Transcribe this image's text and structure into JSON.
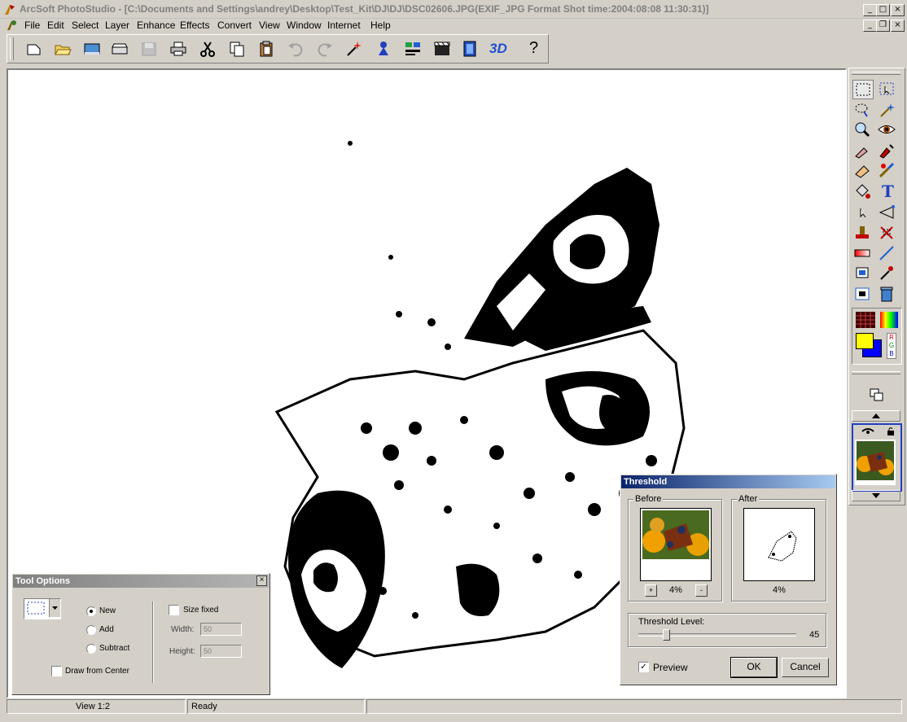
{
  "window": {
    "title": "ArcSoft PhotoStudio - [C:\\Documents and Settings\\andrey\\Desktop\\Test_Kit\\DJ\\DJ\\DSC02606.JPG(EXIF_JPG Format  Shot time:2004:08:08 11:30:31)]",
    "controls": {
      "minimize": "_",
      "maximize": "□",
      "close": "×"
    },
    "doc_controls": {
      "minimize": "_",
      "restore": "❐",
      "close": "×"
    }
  },
  "menu": {
    "items": [
      "File",
      "Edit",
      "Select",
      "Layer",
      "Enhance",
      "Effects",
      "Convert",
      "View",
      "Window",
      "Internet",
      "Help"
    ]
  },
  "toolbar": {
    "threed_label": "3D",
    "help_label": "?"
  },
  "tool_options": {
    "title": "Tool Options",
    "close": "×",
    "mode_new": "New",
    "mode_add": "Add",
    "mode_subtract": "Subtract",
    "draw_from_center": "Draw from Center",
    "size_fixed": "Size fixed",
    "width_label": "Width:",
    "width_value": "50",
    "height_label": "Height:",
    "height_value": "50",
    "selected_mode": "New"
  },
  "threshold": {
    "title": "Threshold",
    "before_label": "Before",
    "after_label": "After",
    "before_zoom": "4%",
    "after_zoom": "4%",
    "zoom_in": "+",
    "zoom_out": "-",
    "level_label": "Threshold Level:",
    "level_value": "45",
    "level_min": 0,
    "level_max": 255,
    "preview_label": "Preview",
    "preview_checked": true,
    "ok_label": "OK",
    "cancel_label": "Cancel"
  },
  "toolbox": {
    "text_tool": "T",
    "rgb_letters": [
      "R",
      "G",
      "B"
    ]
  },
  "status": {
    "view": "View 1:2",
    "state": "Ready"
  },
  "colors": {
    "chrome": "#d4d0c8",
    "active_title": "#0a246a",
    "foreground_swatch": "#ffff00",
    "background_swatch": "#0000ff"
  }
}
